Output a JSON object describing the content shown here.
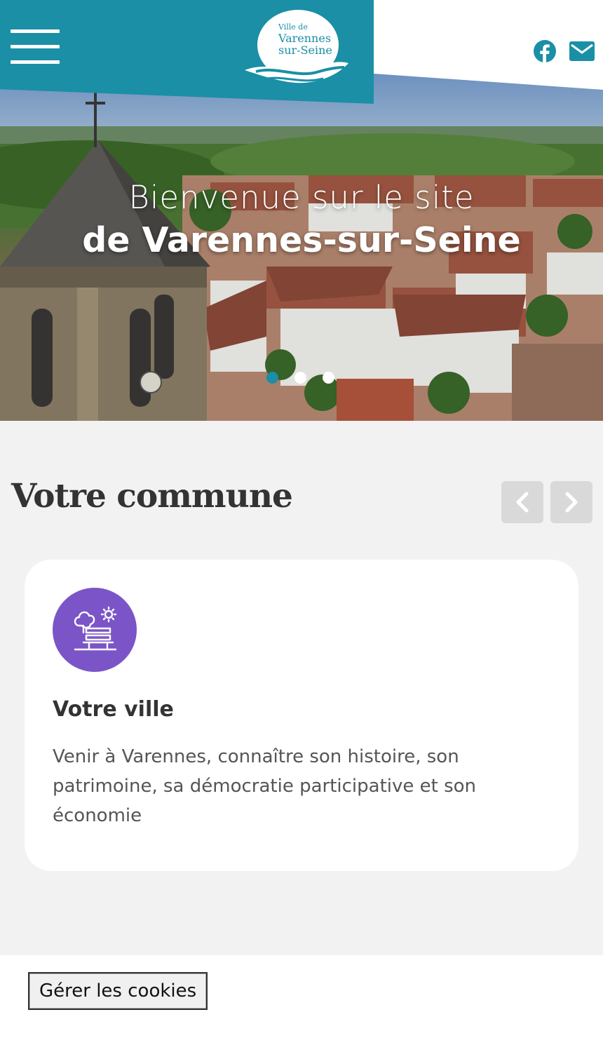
{
  "header": {
    "menu_icon": "hamburger-icon",
    "logo": {
      "line1": "Ville de",
      "line2": "Varennes",
      "line3": "sur-Seine"
    },
    "social": [
      {
        "icon": "facebook-icon"
      },
      {
        "icon": "mail-icon"
      }
    ],
    "colors": {
      "brand": "#1a8fa6"
    }
  },
  "hero": {
    "line1": "Bienvenue sur le site",
    "line2": "de Varennes-sur-Seine",
    "slides_count": 3,
    "active_slide": 1
  },
  "section": {
    "title": "Votre commune",
    "prev_icon": "chevron-left-icon",
    "next_icon": "chevron-right-icon"
  },
  "card": {
    "icon": "park-bench-tree-icon",
    "icon_color": "#7b55c7",
    "title": "Votre ville",
    "text": "Venir à Varennes, connaître son histoire, son patrimoine, sa démocratie participative et son économie"
  },
  "cookies": {
    "button_label": "Gérer les cookies"
  }
}
